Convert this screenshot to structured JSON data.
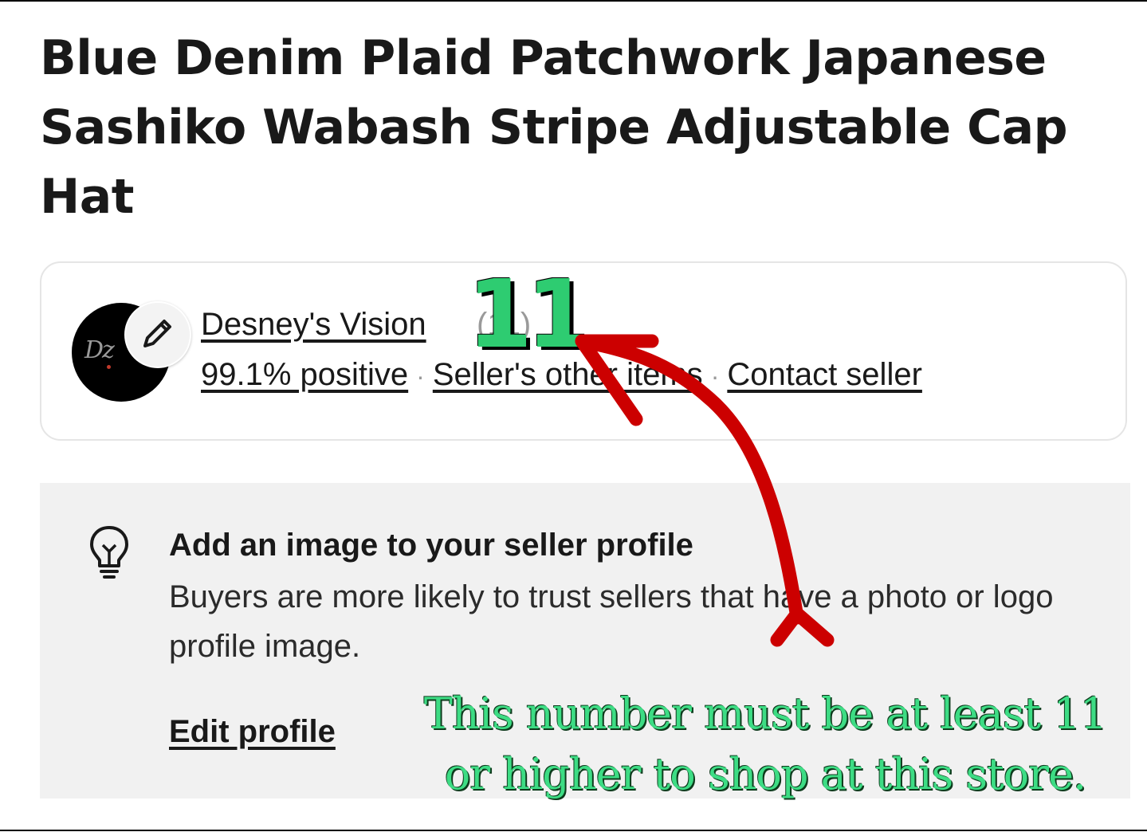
{
  "listing": {
    "title": "Blue Denim Plaid Patchwork Japanese Sashiko Wabash Stripe Adjustable Cap Hat"
  },
  "seller": {
    "name": "Desney's Vision",
    "feedback_score_display": "(11)",
    "positive_feedback": "99.1% positive",
    "other_items_link": "Seller's other items",
    "contact_link": "Contact seller",
    "separator": "·",
    "avatar_icon": "seller-logo-script",
    "edit_icon": "pencil-icon"
  },
  "tip": {
    "icon": "lightbulb-icon",
    "title": "Add an image to your seller profile",
    "body": "Buyers are more likely to trust sellers that have a photo or logo profile image.",
    "edit_link": "Edit profile"
  },
  "annotation": {
    "highlight_number": "11",
    "note": "This number must be at least 11 or higher to shop at this store.",
    "number_color": "#2ecc71",
    "arrow_color": "#cc0000"
  }
}
